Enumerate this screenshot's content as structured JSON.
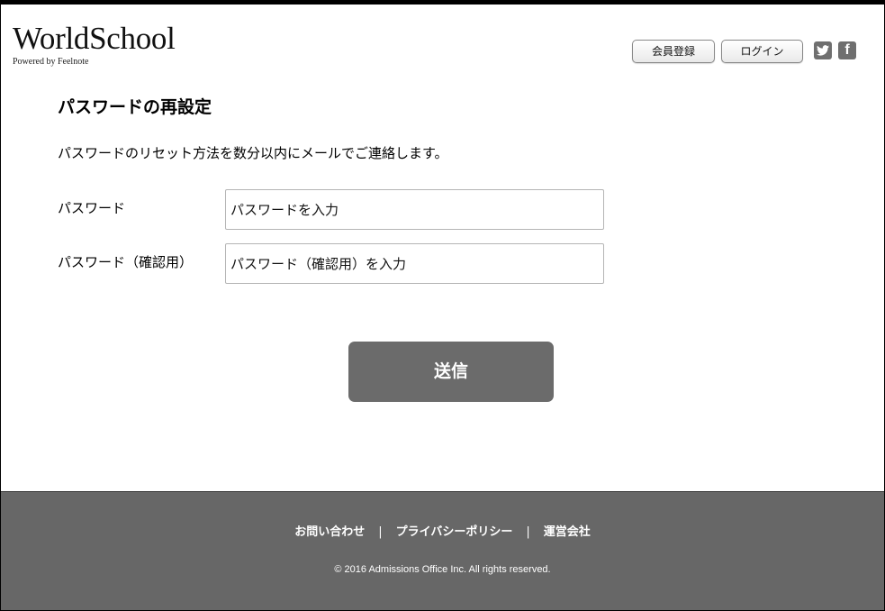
{
  "header": {
    "logo_title": "WorldSchool",
    "logo_subtitle": "Powered by Feelnote",
    "register_label": "会員登録",
    "login_label": "ログイン",
    "facebook_glyph": "f"
  },
  "main": {
    "title": "パスワードの再設定",
    "description": "パスワードのリセット方法を数分以内にメールでご連絡します。",
    "password_label": "パスワード",
    "password_placeholder": "パスワードを入力",
    "password_value": "",
    "confirm_label": "パスワード（確認用）",
    "confirm_placeholder": "パスワード（確認用）を入力",
    "confirm_value": "",
    "submit_label": "送信"
  },
  "footer": {
    "links": [
      "お問い合わせ",
      "プライバシーポリシー",
      "運営会社"
    ],
    "separator": "|",
    "copyright": "© 2016 Admissions Office Inc. All rights reserved."
  },
  "icons": {
    "twitter": "twitter-icon",
    "facebook": "facebook-icon"
  },
  "colors": {
    "button_primary": "#6b6b6b",
    "footer_bg": "#676767",
    "social_bg": "#6f6f6f"
  }
}
